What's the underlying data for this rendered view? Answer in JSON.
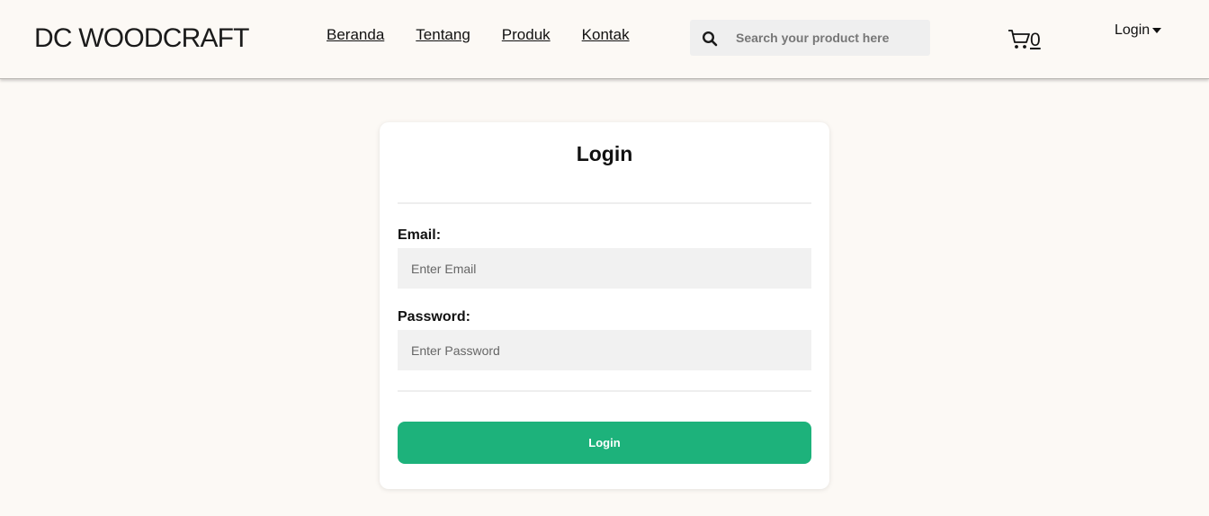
{
  "header": {
    "brand": "DC WOODCRAFT",
    "nav": [
      {
        "label": "Beranda"
      },
      {
        "label": "Tentang"
      },
      {
        "label": "Produk"
      },
      {
        "label": "Kontak"
      }
    ],
    "search": {
      "placeholder": "Search your product here",
      "value": ""
    },
    "cart_count": "0",
    "login_menu": "Login"
  },
  "form": {
    "title": "Login",
    "email": {
      "label": "Email:",
      "placeholder": "Enter Email",
      "value": ""
    },
    "password": {
      "label": "Password:",
      "placeholder": "Enter Password",
      "value": ""
    },
    "submit_label": "Login"
  },
  "icons": {
    "search": "search-icon",
    "cart": "cart-icon",
    "dropdown": "caret-down-icon"
  },
  "colors": {
    "page_background": "#fcf9f5",
    "accent": "#1db27b",
    "input_background": "#f1f1f1"
  }
}
